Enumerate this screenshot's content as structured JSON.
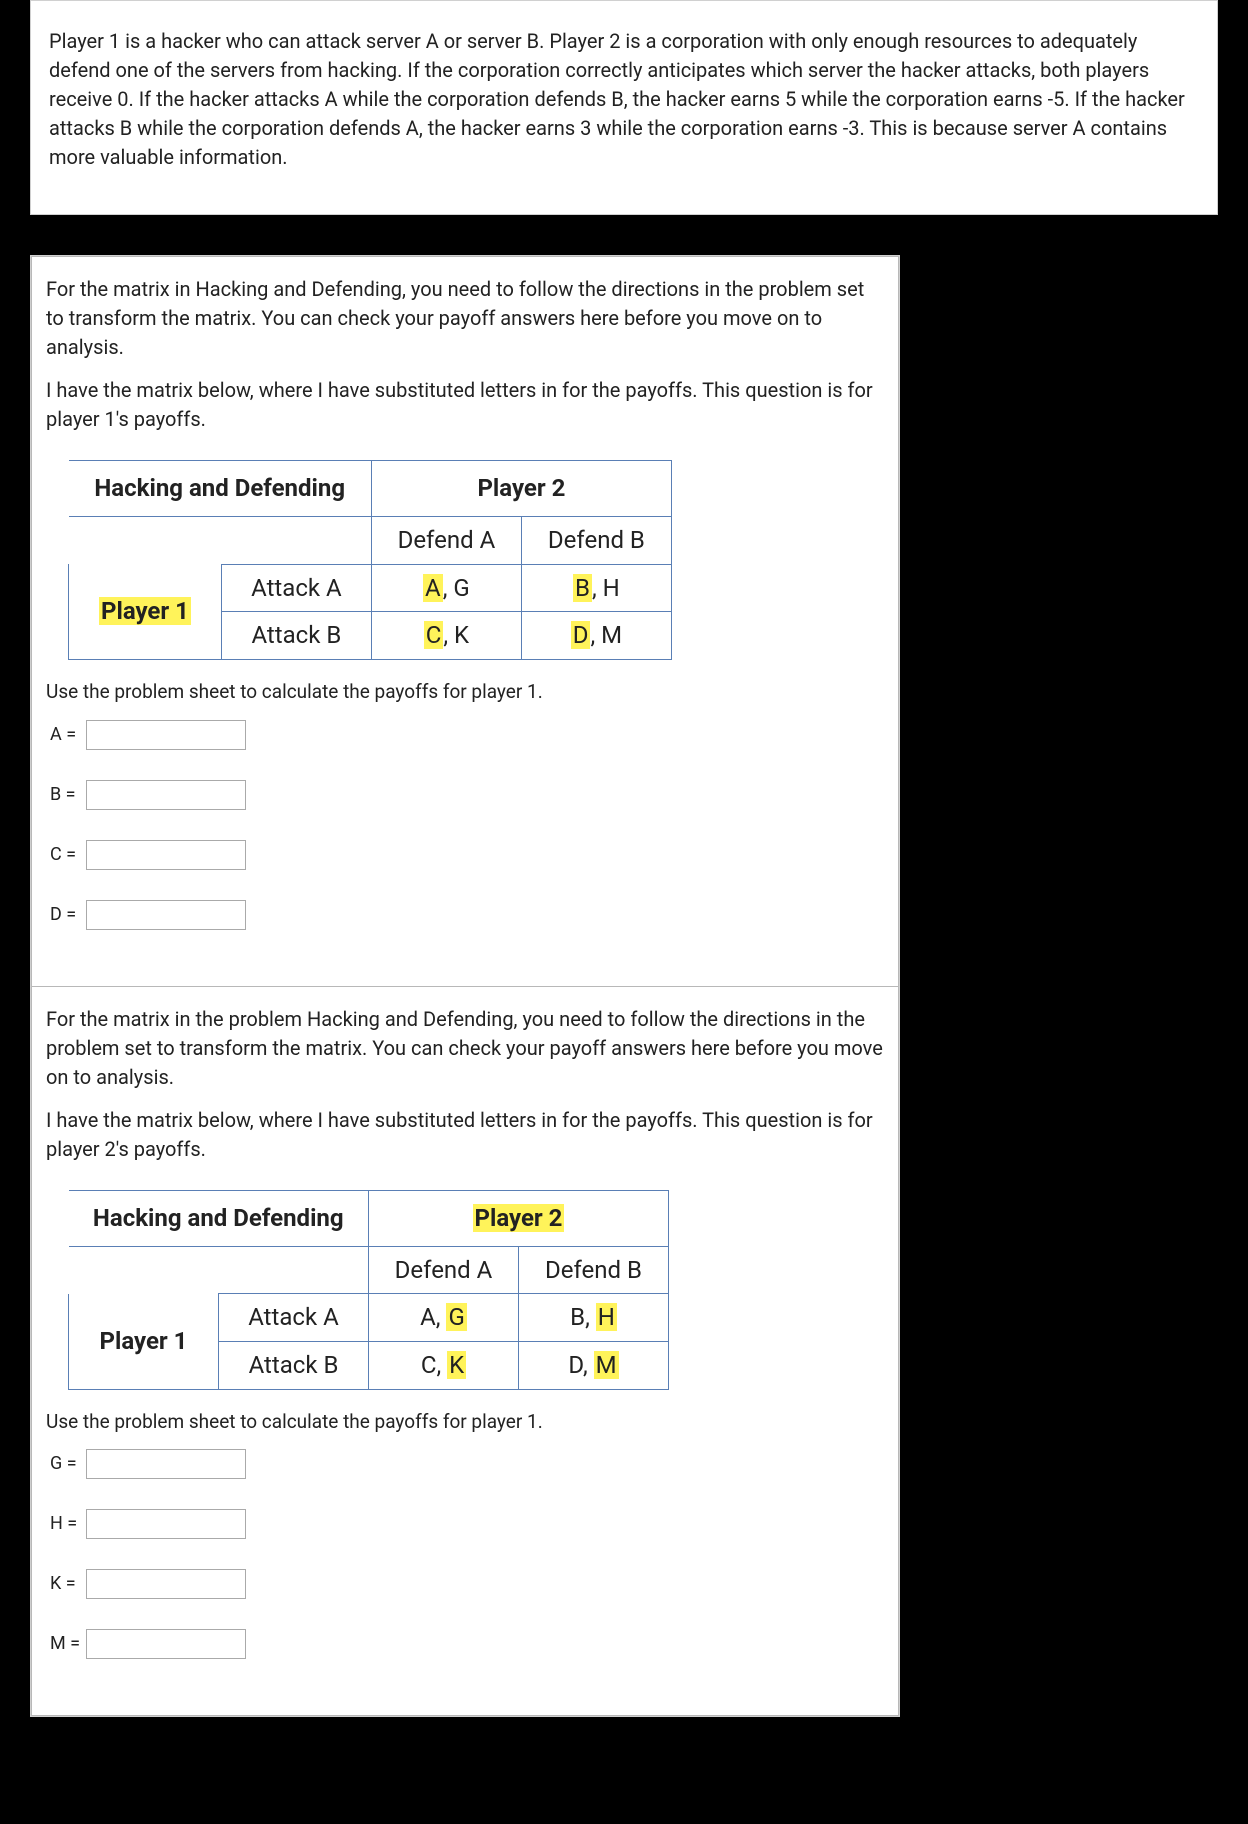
{
  "intro": "Player 1 is a hacker who can attack server A or server B. Player 2 is a corporation with only enough resources to adequately defend one of the servers from hacking. If the corporation correctly anticipates which server the hacker attacks, both players receive 0. If the hacker attacks A while the corporation defends B, the hacker earns 5 while the corporation earns -5. If the hacker attacks B while the corporation defends A, the hacker earns 3 while the corporation earns -3. This is because server A contains more valuable information.",
  "q1": {
    "p1": "For the matrix in Hacking and Defending, you need to follow the directions in the problem set to transform the matrix. You can check your payoff answers here before you move on to analysis.",
    "p2": "I have the matrix below, where I have substituted letters in for the payoffs.  This question is for player 1's payoffs.",
    "table": {
      "title": "Hacking and Defending",
      "player2": "Player 2",
      "player1": "Player 1",
      "defendA": "Defend A",
      "defendB": "Defend B",
      "attackA": "Attack A",
      "attackB": "Attack B",
      "cellAA_p1": "A",
      "cellAA_sep": ",  ",
      "cellAA_p2": "G",
      "cellAB_p1": "B",
      "cellAB_sep": ",  ",
      "cellAB_p2": "H",
      "cellBA_p1": "C",
      "cellBA_sep": ",  ",
      "cellBA_p2": "K",
      "cellBB_p1": "D",
      "cellBB_sep": ",  ",
      "cellBB_p2": "M"
    },
    "instr": "Use the problem sheet to calculate the payoffs for player 1.",
    "labels": {
      "A": "A =",
      "B": "B =",
      "C": "C =",
      "D": "D ="
    },
    "values": {
      "A": "",
      "B": "",
      "C": "",
      "D": ""
    }
  },
  "q2": {
    "p1": "For the matrix in the problem Hacking and Defending, you need to follow the directions in the problem set to transform the matrix. You can check your payoff answers here before you move on to analysis.",
    "p2": "I have the matrix below, where I have substituted letters in for the payoffs.  This question is for player 2's payoffs.",
    "table": {
      "title": "Hacking and Defending",
      "player2": "Player 2",
      "player1": "Player 1",
      "defendA": "Defend A",
      "defendB": "Defend B",
      "attackA": "Attack A",
      "attackB": "Attack B",
      "cellAA_p1": "A",
      "cellAA_sep": ",  ",
      "cellAA_p2": "G",
      "cellAB_p1": "B",
      "cellAB_sep": ",  ",
      "cellAB_p2": "H",
      "cellBA_p1": "C",
      "cellBA_sep": ",  ",
      "cellBA_p2": "K",
      "cellBB_p1": "D",
      "cellBB_sep": ",  ",
      "cellBB_p2": "M"
    },
    "instr": "Use the problem sheet to calculate the payoffs for player 1.",
    "labels": {
      "G": "G =",
      "H": "H =",
      "K": "K =",
      "M": "M ="
    },
    "values": {
      "G": "",
      "H": "",
      "K": "",
      "M": ""
    }
  }
}
